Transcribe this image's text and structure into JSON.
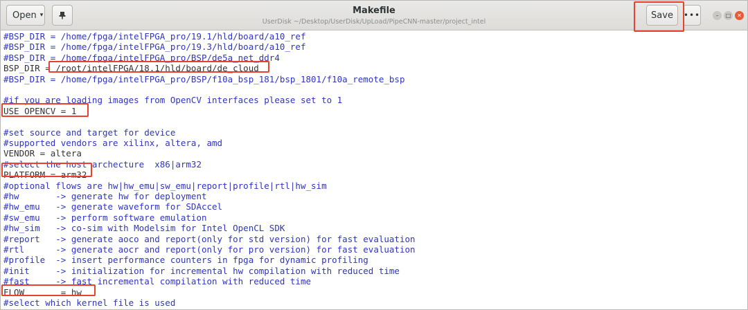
{
  "header": {
    "open_label": "Open",
    "caret": "▾",
    "pin_icon": "pin-icon",
    "title": "Makefile",
    "subtitle": "UserDisk ~/Desktop/UserDisk/UpLoad/PipeCNN-master/project_intel",
    "save_label": "Save",
    "menu_label": "•••",
    "controls": {
      "minimize": "–",
      "maximize": "□",
      "close": "✕"
    }
  },
  "colors": {
    "comment": "#2d35c3",
    "code": "#333333",
    "highlight": "#e8412e",
    "close_button": "#e85b35"
  },
  "editor": {
    "lines": [
      {
        "kind": "comment",
        "text": "#BSP_DIR = /home/fpga/intelFPGA_pro/19.1/hld/board/a10_ref"
      },
      {
        "kind": "comment",
        "text": "#BSP_DIR = /home/fpga/intelFPGA_pro/19.3/hld/board/a10_ref"
      },
      {
        "kind": "comment",
        "text": "#BSP_DIR = /home/fpga/intelFPGA_pro/BSP/de5a_net_ddr4"
      },
      {
        "kind": "code",
        "text": "BSP_DIR = /root/intelFPGA/18.1/hld/board/de_cloud"
      },
      {
        "kind": "comment",
        "text": "#BSP_DIR = /home/fpga/intelFPGA_pro/BSP/f10a_bsp_181/bsp_1801/f10a_remote_bsp"
      },
      {
        "kind": "blank",
        "text": ""
      },
      {
        "kind": "comment",
        "text": "#if you are loading images from OpenCV interfaces please set to 1"
      },
      {
        "kind": "code",
        "text": "USE_OPENCV = 1"
      },
      {
        "kind": "blank",
        "text": ""
      },
      {
        "kind": "comment",
        "text": "#set source and target for device"
      },
      {
        "kind": "comment",
        "text": "#supported vendors are xilinx, altera, amd"
      },
      {
        "kind": "code",
        "text": "VENDOR = altera"
      },
      {
        "kind": "comment",
        "text": "#select the host archecture  x86|arm32"
      },
      {
        "kind": "code",
        "text": "PLATFORM = arm32"
      },
      {
        "kind": "comment",
        "text": "#optional flows are hw|hw_emu|sw_emu|report|profile|rtl|hw_sim"
      },
      {
        "kind": "comment",
        "text": "#hw       -> generate hw for deployment"
      },
      {
        "kind": "comment",
        "text": "#hw_emu   -> generate waveform for SDAccel"
      },
      {
        "kind": "comment",
        "text": "#sw_emu   -> perform software emulation"
      },
      {
        "kind": "comment",
        "text": "#hw_sim   -> co-sim with Modelsim for Intel OpenCL SDK"
      },
      {
        "kind": "comment",
        "text": "#report   -> generate aoco and report(only for std version) for fast evaluation"
      },
      {
        "kind": "comment",
        "text": "#rtl      -> generate aocr and report(only for pro version) for fast evaluation"
      },
      {
        "kind": "comment",
        "text": "#profile  -> insert performance counters in fpga for dynamic profiling"
      },
      {
        "kind": "comment",
        "text": "#init     -> initialization for incremental hw compilation with reduced time"
      },
      {
        "kind": "comment",
        "text": "#fast     -> fast incremental compilation with reduced time"
      },
      {
        "kind": "code",
        "text": "FLOW       = hw"
      },
      {
        "kind": "comment",
        "text": "#select which kernel file is used"
      }
    ]
  }
}
